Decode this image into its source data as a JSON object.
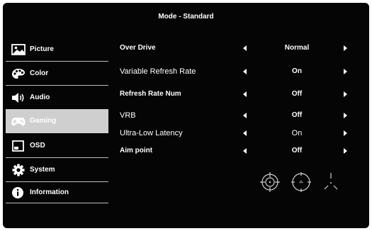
{
  "header": {
    "title": "Mode - Standard"
  },
  "sidebar": {
    "items": [
      {
        "label": "Picture",
        "icon": "picture-icon"
      },
      {
        "label": "Color",
        "icon": "palette-icon"
      },
      {
        "label": "Audio",
        "icon": "speaker-icon"
      },
      {
        "label": "Gaming",
        "icon": "gamepad-icon",
        "active": true
      },
      {
        "label": "OSD",
        "icon": "osd-icon"
      },
      {
        "label": "System",
        "icon": "gear-icon"
      },
      {
        "label": "Information",
        "icon": "info-icon"
      }
    ]
  },
  "settings": [
    {
      "label": "Over Drive",
      "value": "Normal"
    },
    {
      "label": "Variable Refresh Rate",
      "value": "On"
    },
    {
      "label": "Refresh Rate Num",
      "value": "Off"
    },
    {
      "label": "VRB",
      "value": "Off"
    },
    {
      "label": "Ultra-Low Latency",
      "value": "On"
    },
    {
      "label": "Aim point",
      "value": "Off"
    }
  ],
  "aim_point_options": [
    {
      "icon": "crosshair-circle-target-icon"
    },
    {
      "icon": "crosshair-dot-circle-icon"
    },
    {
      "icon": "crosshair-tri-line-icon"
    }
  ],
  "colors": {
    "background": "#050505",
    "active_item": "#cfcfcf",
    "text": "#ffffff",
    "divider": "#bdbdbd"
  }
}
